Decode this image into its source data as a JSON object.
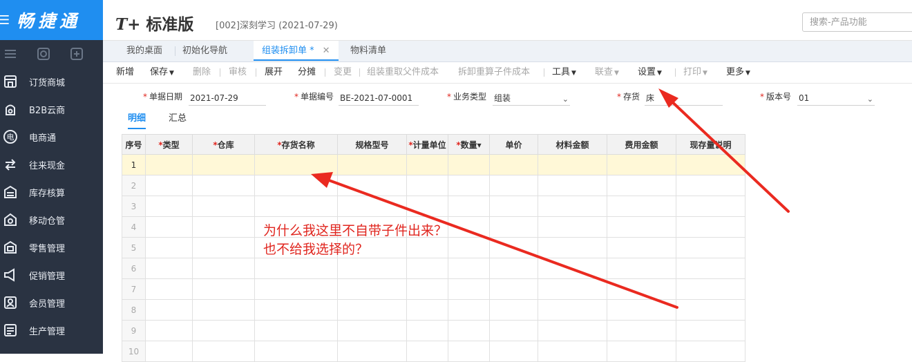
{
  "brand": "畅捷通",
  "header": {
    "product_mark": "T+",
    "product_name": "标准版",
    "account_info": "[002]深刻学习   (2021-07-29)",
    "search_placeholder": "搜索-产品功能"
  },
  "sidebar": {
    "items": [
      {
        "label": "订货商城",
        "icon": "store-icon"
      },
      {
        "label": "B2B云商",
        "icon": "cloud-shop-icon"
      },
      {
        "label": "电商通",
        "icon": "ecommerce-icon"
      },
      {
        "label": "往来现金",
        "icon": "exchange-icon"
      },
      {
        "label": "库存核算",
        "icon": "inventory-icon"
      },
      {
        "label": "移动仓管",
        "icon": "mobile-warehouse-icon"
      },
      {
        "label": "零售管理",
        "icon": "retail-icon"
      },
      {
        "label": "促销管理",
        "icon": "megaphone-icon"
      },
      {
        "label": "会员管理",
        "icon": "member-icon"
      },
      {
        "label": "生产管理",
        "icon": "production-icon"
      }
    ]
  },
  "tabs": [
    {
      "label": "我的桌面"
    },
    {
      "label": "初始化导航"
    },
    {
      "label": "组装拆卸单 *",
      "active": true
    },
    {
      "label": "物料清单"
    }
  ],
  "tab_close": "✕",
  "toolbar": {
    "new": "新增",
    "save": "保存",
    "delete": "删除",
    "audit": "审核",
    "expand": "展开",
    "split": "分摊",
    "change": "变更",
    "assembly_recalc": "组装重取父件成本",
    "disassembly_recalc": "拆卸重算子件成本",
    "tools": "工具",
    "lookup": "联查",
    "settings": "设置",
    "print": "打印",
    "more": "更多"
  },
  "form": {
    "doc_date_label": "单据日期",
    "doc_date": "2021-07-29",
    "doc_no_label": "单据编号",
    "doc_no": "BE-2021-07-0001",
    "biz_type_label": "业务类型",
    "biz_type": "组装",
    "stock_label": "存货",
    "stock": "床",
    "version_label": "版本号",
    "version": "01"
  },
  "subtabs": {
    "detail": "明细",
    "summary": "汇总"
  },
  "grid": {
    "columns": [
      {
        "label": "序号",
        "required": false
      },
      {
        "label": "类型",
        "required": true
      },
      {
        "label": "仓库",
        "required": true
      },
      {
        "label": "存货名称",
        "required": true
      },
      {
        "label": "规格型号",
        "required": false
      },
      {
        "label": "计量单位",
        "required": true
      },
      {
        "label": "数量",
        "required": true,
        "sort": "▾"
      },
      {
        "label": "单价",
        "required": false
      },
      {
        "label": "材料金额",
        "required": false
      },
      {
        "label": "费用金额",
        "required": false
      },
      {
        "label": "现存量说明",
        "required": false
      }
    ],
    "row_numbers": [
      "1",
      "2",
      "3",
      "4",
      "5",
      "6",
      "7",
      "8",
      "9",
      "10"
    ],
    "selected_row": 1
  },
  "annotation": {
    "line1": "为什么我这里不自带子件出来？",
    "line2": "也不给我选择的？",
    "color": "#e0261f"
  }
}
